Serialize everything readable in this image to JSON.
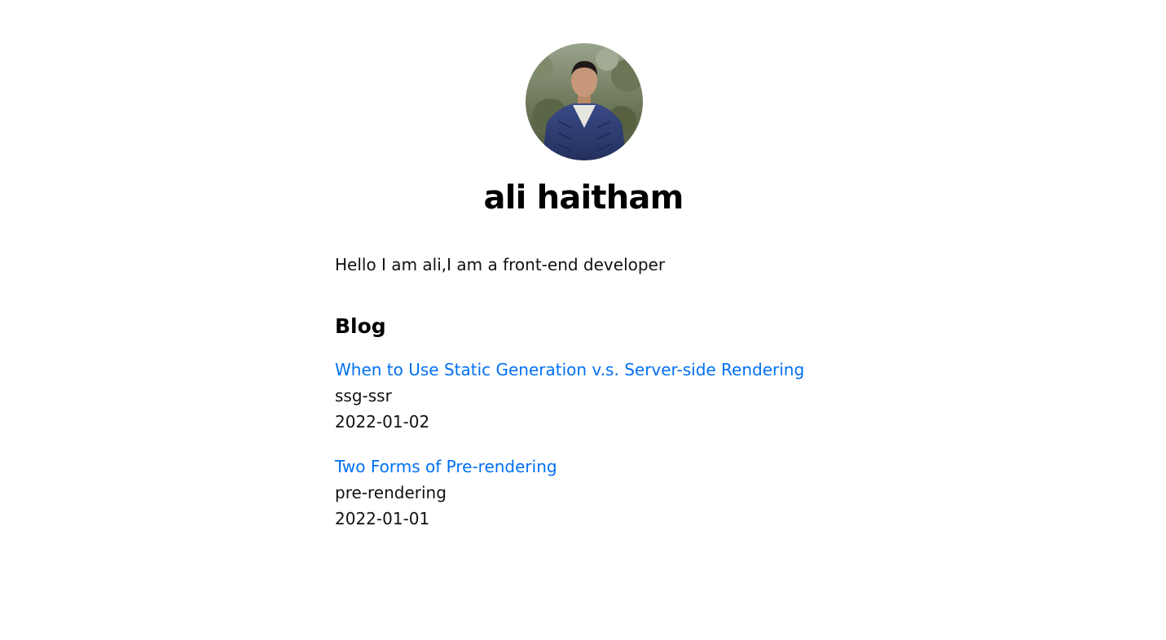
{
  "profile": {
    "name": "ali haitham",
    "intro": "Hello I am ali,I am a front-end developer"
  },
  "blog": {
    "heading": "Blog",
    "posts": [
      {
        "title": "When to Use Static Generation v.s. Server-side Rendering",
        "id": "ssg-ssr",
        "date": "2022-01-02"
      },
      {
        "title": "Two Forms of Pre-rendering",
        "id": "pre-rendering",
        "date": "2022-01-01"
      }
    ]
  },
  "colors": {
    "link": "#0070f3",
    "text": "#111111",
    "background": "#ffffff"
  }
}
